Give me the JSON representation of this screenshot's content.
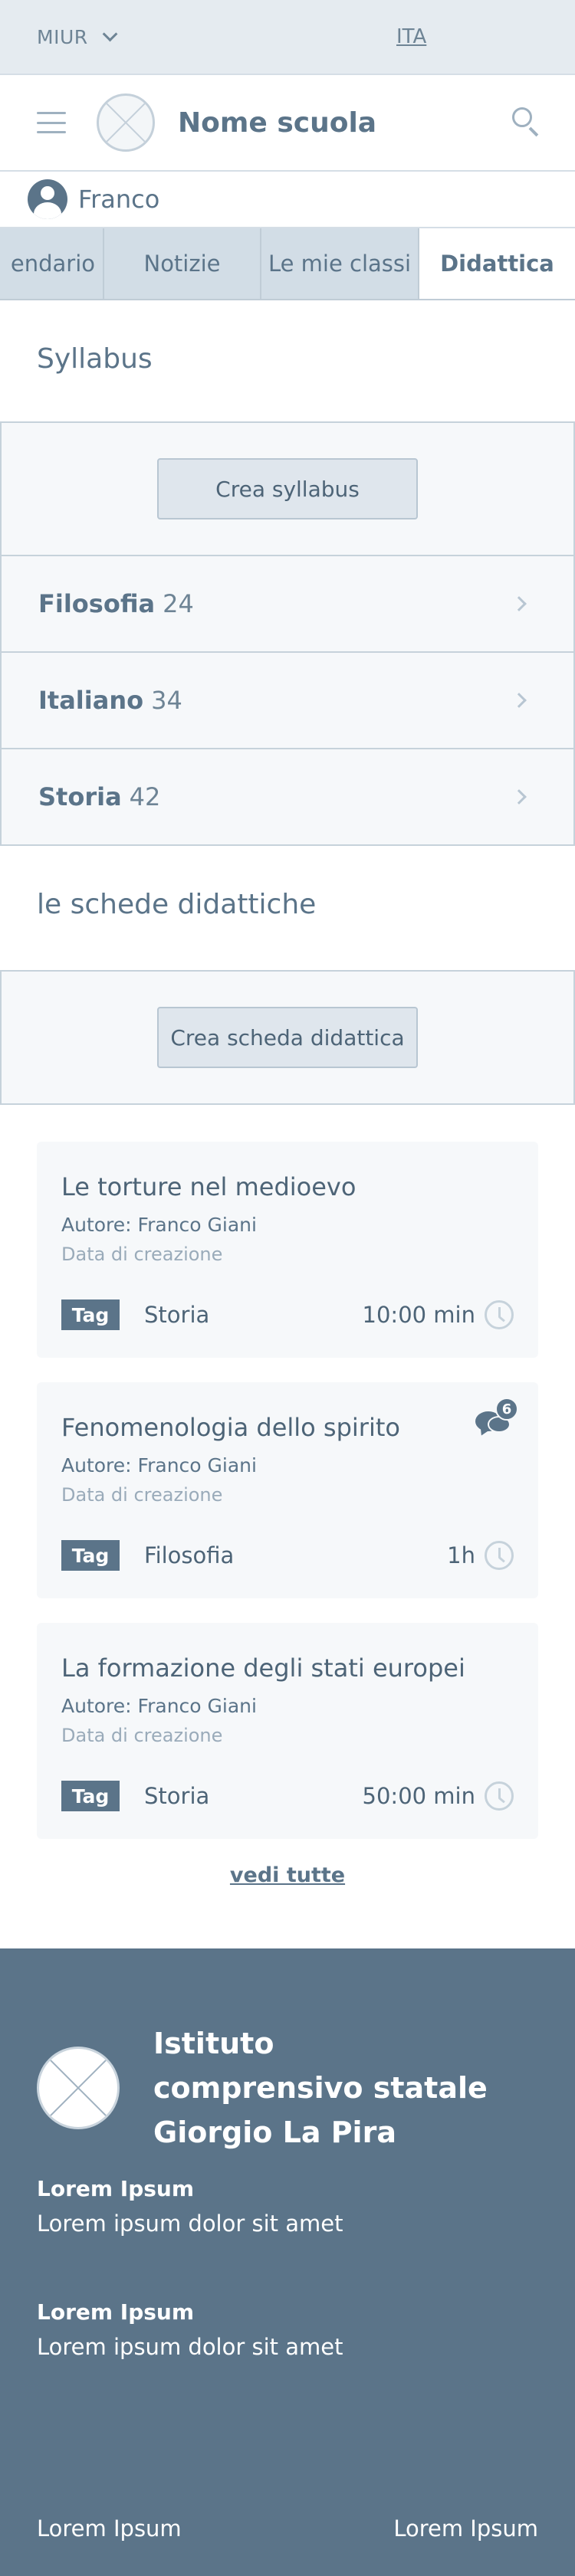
{
  "topbar": {
    "org": "MIUR",
    "lang": "ITA"
  },
  "header": {
    "school_name": "Nome scuola"
  },
  "user": {
    "name": "Franco"
  },
  "tabs": [
    {
      "label": "endario"
    },
    {
      "label": "Notizie"
    },
    {
      "label": "Le mie classi"
    },
    {
      "label": "Didattica"
    }
  ],
  "syllabus": {
    "title": "Syllabus",
    "create_label": "Crea syllabus",
    "subjects": [
      {
        "name": "Filosofia",
        "count": "24"
      },
      {
        "name": "Italiano",
        "count": "34"
      },
      {
        "name": "Storia",
        "count": "42"
      }
    ]
  },
  "schede": {
    "title": "le schede didattiche",
    "create_label": "Crea scheda didattica",
    "cards": [
      {
        "title": "Le torture nel medioevo",
        "author_label": "Autore:",
        "author": "Franco Giani",
        "created": "Data di creazione",
        "tag": "Tag",
        "subject": "Storia",
        "duration": "10:00 min"
      },
      {
        "title": "Fenomenologia dello spirito",
        "author_label": "Autore:",
        "author": "Franco Giani",
        "created": "Data di creazione",
        "tag": "Tag",
        "subject": "Filosofia",
        "duration": "1h",
        "comments": "6"
      },
      {
        "title": "La formazione degli stati europei",
        "author_label": "Autore:",
        "author": "Franco Giani",
        "created": "Data di creazione",
        "tag": "Tag",
        "subject": "Storia",
        "duration": "50:00 min"
      }
    ],
    "see_all": "vedi tutte"
  },
  "footer": {
    "institute": "Istituto comprensivo statale Giorgio La Pira",
    "blocks": [
      {
        "title": "Lorem Ipsum",
        "text": "Lorem ipsum dolor sit amet"
      },
      {
        "title": "Lorem Ipsum",
        "text": "Lorem ipsum dolor sit amet"
      }
    ],
    "links": [
      "Lorem Ipsum",
      "Lorem Ipsum"
    ]
  },
  "icons": {
    "menu": "hamburger-icon",
    "search": "search-icon",
    "user": "user-avatar-icon",
    "chevron": "chevron-right-icon",
    "clock": "clock-icon",
    "comments": "comments-icon"
  }
}
